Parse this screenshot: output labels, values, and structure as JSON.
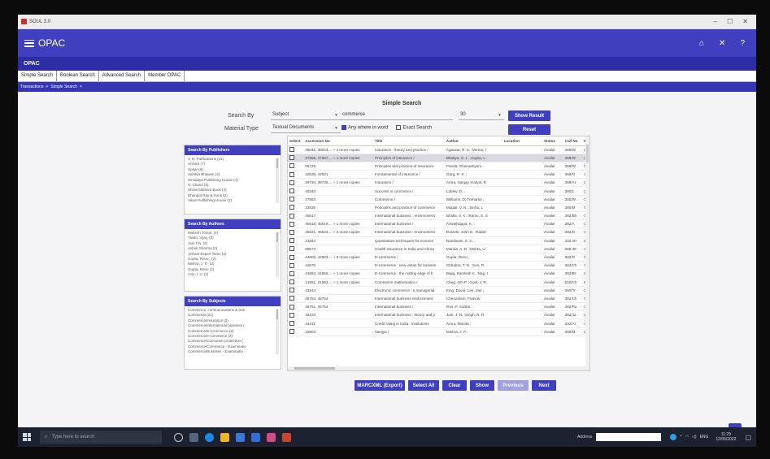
{
  "window": {
    "title": "SOUL 3.0",
    "controls": [
      "–",
      "☐",
      "✕"
    ]
  },
  "appbar": {
    "title": "OPAC",
    "icons": [
      "home-icon",
      "close-icon",
      "help-icon"
    ]
  },
  "page_title": "OPAC",
  "tabs": [
    "Simple Search",
    "Boolean Search",
    "Advanced Search",
    "Member OPAC"
  ],
  "breadcrumb": {
    "root": "Transactions ->",
    "current": "Simple Search",
    "close": "×"
  },
  "form": {
    "title": "Simple Search",
    "search_by_label": "Search By",
    "search_by_value": "Subject",
    "search_term": "commerce",
    "results_count": "30",
    "material_label": "Material Type",
    "material_value": "Textual Documents",
    "anywhere_label": "Any where in word",
    "anywhere_checked": true,
    "exact_label": "Exact Search",
    "exact_checked": false,
    "show_result": "Show Result",
    "reset": "Reset"
  },
  "publishers": {
    "title": "Search By Publishers",
    "items": [
      "V. K. Publications (14)",
      "Arihant (7)",
      "Upkar (6)",
      "Sahitya Bhawan (4)",
      "Himalaya Publishing House (4)",
      "S. Chand (3)",
      "Shree Mahavir Book (3)",
      "Dhanpat Ray & Sons (2)",
      "Vikas Publishing House (2)"
    ]
  },
  "authors": {
    "title": "Search By Authors",
    "items": [
      "Mukesh Tomar, (4)",
      "Tiwari, Vijay, (3)",
      "Jain T.R. (2)",
      "Ashok Sharma (2)",
      "Arihant Expert Team (2)",
      "Gupta, Renu , (2)",
      "Mishra, J. P., (2)",
      "Gupta, Renu (2)",
      "Aziz, I. V. (2)"
    ]
  },
  "subjects": {
    "title": "Search By Subjects",
    "items": [
      "Commerce, communications & tran",
      "Commerce (21)",
      "Commerce/Insurance (3)",
      "Commerce/International business (",
      "Commerce/E-Commerce (2)",
      "Commerce/e-commerce (2)",
      "Commerce/Consumer protection (",
      "Commerce/Commerce - Examinatio",
      "Commerce/Business - Examinatio"
    ]
  },
  "table": {
    "headers": [
      "Select",
      "Accession No",
      "Title",
      "Author",
      "Location",
      "Status",
      "Call No",
      "B"
    ],
    "selected_row": 1,
    "rows": [
      [
        "38042, 38044,... + 2 more copies",
        "Insurance : theory and practice /",
        "Agarwal, R. K. ;Verma, I",
        "",
        "Availal",
        "368/W",
        "C"
      ],
      [
        "37966, 37967,... + 1 more copies",
        "Principles of insurance /",
        "Bhatiya, G. L. ;Gupta, L",
        "",
        "Availal",
        "368/W",
        "C"
      ],
      [
        "09729",
        "Principles and practice of insurance",
        "Panda, Ghanashyam ;",
        "",
        "Availal",
        "368/W",
        "C"
      ],
      [
        "42630, 42631",
        "Fundamental of insurance /",
        "Garg, R. K. ;",
        "",
        "Availal",
        "368/G",
        "C"
      ],
      [
        "39734, 39735,... + 1 more copies",
        "Insurance /",
        "Arora, Sanjay ;Katyal, R",
        "",
        "Availal",
        "368/AI",
        "C"
      ],
      [
        "40340",
        "Success in commerce /",
        "Lobley, D. ;",
        "",
        "Availal",
        "380/L",
        "C"
      ],
      [
        "37863",
        "Commerce /",
        "Williams, D; Treharne ;",
        "",
        "Availal",
        "380/W",
        "C"
      ],
      [
        "32836",
        "Principles and practice of commerce",
        "Mugali, V. N. ;Sinha, L",
        "",
        "Availal",
        "380/M",
        "C"
      ],
      [
        "45517",
        "International business : environment",
        "Bhalla, V. K. ;Ramu, S. S",
        "",
        "Availal",
        "382/Bh",
        "C"
      ],
      [
        "45518, 45519,... + 1 more copies",
        "International business /",
        "Aswathappa, K. ;",
        "",
        "Availal",
        "382/A",
        "C"
      ],
      [
        "45521, 45522,... + 2 more copies",
        "International business : environment",
        "Daniels, John D. ;Radet",
        "",
        "Availal",
        "382/D",
        "C"
      ],
      [
        "31844",
        "Quantitative techniques for econom",
        "Nandwani, S. C. ;",
        "",
        "Availal",
        "332.40",
        "E"
      ],
      [
        "08573",
        "Health insurance in India and Abroa",
        "Manda, A. D. ;Mehta, U",
        "",
        "Availal",
        "368.38",
        "C"
      ],
      [
        "44902, 44903,... + 8 more copies",
        "E-commerce /",
        "Gupta, Renu ;",
        "",
        "Availal",
        "382/G",
        "C"
      ],
      [
        "42670",
        "E-commerce : new vistas for busines",
        "Chhabra, T. N. ;Suri, R.",
        "",
        "Availal",
        "382/Ch",
        "C"
      ],
      [
        "41653, 41656,... + 1 more copies",
        "E-commerce : the cutting edge of b",
        "Bajaj, Kamlesh K. ;Nag, I",
        "",
        "Availal",
        "382/Bc",
        "C"
      ],
      [
        "41551, 41552,... + 1 more copies",
        "Commerce mathematics /",
        "Chug, Om P. ;Goel, J. R.",
        "",
        "Availal",
        "510/Ch",
        "K"
      ],
      [
        "43244",
        "Electronic commerce : a managerial",
        "King, David ;Lee, Jae ;",
        "",
        "Availal",
        "380/Tr",
        "C"
      ],
      [
        "45753, 45754",
        "International business environment",
        "Cherunilam, Francis ;",
        "",
        "Availal",
        "382/Ch",
        "C"
      ],
      [
        "45751, 45752",
        "International business /",
        "Rao, P. Subba ;",
        "",
        "Availal",
        "382/Ra",
        "C"
      ],
      [
        "45223",
        "International business : theory and p",
        "Jain, J. N. ;Singh, R. R.",
        "",
        "Availal",
        "382/Ja",
        "C"
      ],
      [
        "44211",
        "Credit rating in India : institutions",
        "Arora, Mamta ;",
        "",
        "Availal",
        "332/Ar",
        "C"
      ],
      [
        "32803",
        "Vanijya /",
        "Mishra, J. P.;",
        "",
        "Availal",
        "380/M",
        "C"
      ]
    ]
  },
  "actions": [
    "MARCXML (Export)",
    "Select All",
    "Clear",
    "Show",
    "Previous",
    "Next"
  ],
  "fab": "↑",
  "taskbar": {
    "search_placeholder": "Type here to search",
    "address_label": "Address",
    "lang": "ENG",
    "time": "11:29",
    "date": "12/05/2022"
  },
  "colors": {
    "primary": "#3f3fbf",
    "dark": "#2d2da6",
    "taskbar": "#1c2230"
  }
}
